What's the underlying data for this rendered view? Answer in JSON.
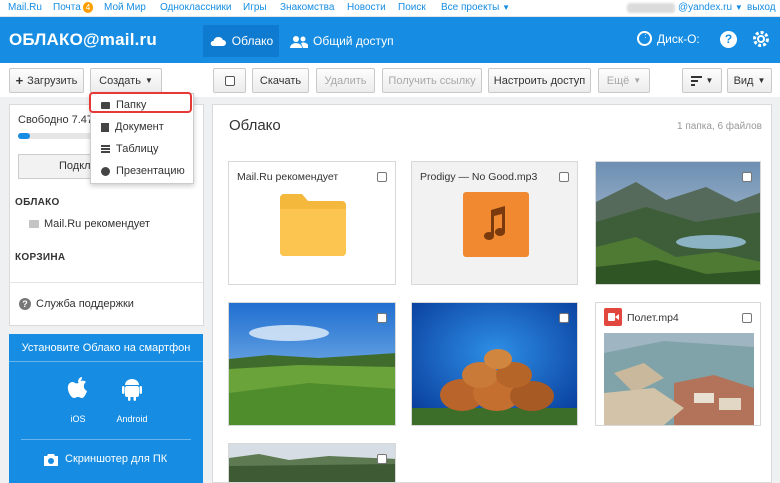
{
  "portal": {
    "links": [
      "Mail.Ru",
      "Почта",
      "Мой Мир",
      "Одноклассники",
      "Игры",
      "Знакомства",
      "Новости",
      "Поиск",
      "Все проекты"
    ],
    "mail_count": "4",
    "account": "@yandex.ru",
    "logout": "выход"
  },
  "header": {
    "logo": "ОБЛАКО@mail.ru",
    "nav_cloud": "Облако",
    "nav_shared": "Общий доступ",
    "disk": "Диск-О:",
    "help": "?"
  },
  "toolbar": {
    "upload": "Загрузить",
    "create": "Создать",
    "download": "Скачать",
    "delete": "Удалить",
    "get_link": "Получить ссылку",
    "share": "Настроить доступ",
    "more": "Ещё",
    "view": "Вид"
  },
  "create_menu": {
    "items": [
      "Папку",
      "Документ",
      "Таблицу",
      "Презентацию"
    ]
  },
  "sidebar": {
    "storage": "Свободно 7.47",
    "storage_fraction": 0.07,
    "upgrade": "Подкл",
    "section_cloud": "ОБЛАКО",
    "tree_item": "Mail.Ru рекомендует",
    "section_trash": "КОРЗИНА",
    "support": "Служба поддержки"
  },
  "promo": {
    "title": "Установите Облако на смартфон",
    "ios": "iOS",
    "android": "Android",
    "screenshoter": "Скриншотер для ПК"
  },
  "content": {
    "title": "Облако",
    "meta": "1 папка, 6 файлов",
    "files": [
      {
        "name": "Mail.Ru рекомендует",
        "type": "folder"
      },
      {
        "name": "Prodigy — No Good.mp3",
        "type": "audio"
      },
      {
        "name": "",
        "type": "image"
      },
      {
        "name": "",
        "type": "image"
      },
      {
        "name": "",
        "type": "image"
      },
      {
        "name": "Полет.mp4",
        "type": "video"
      },
      {
        "name": "",
        "type": "image"
      }
    ]
  },
  "colors": {
    "brand": "#168de2",
    "folder": "#fbc54f",
    "audio": "#f0892f",
    "video": "#e2473f",
    "highlight": "#e53935"
  }
}
